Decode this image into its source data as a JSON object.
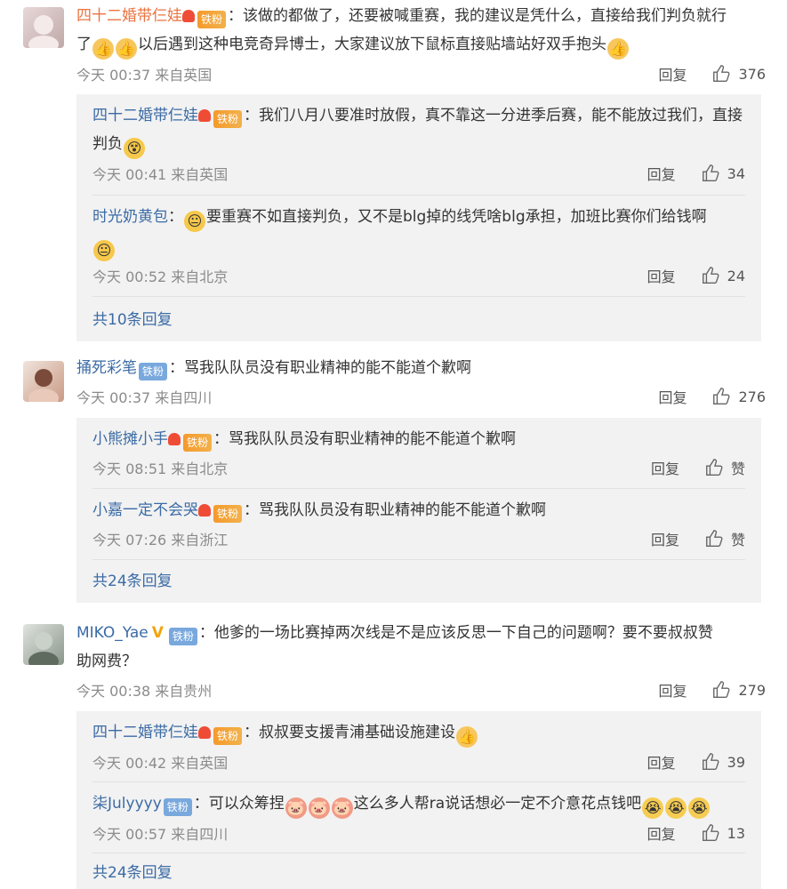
{
  "comments": [
    {
      "user": "四十二婚带仨娃",
      "badge": "铁粉",
      "text1": "：该做的都做了，还要被喊重赛，我的建议是凭什么，直接给我们判负就行",
      "text2a": "了",
      "text2b": "以后遇到这种电竞奇异博士，大家建议放下鼠标直接贴墙站好双手抱头",
      "meta": "今天 00:37 来自英国",
      "reply_label": "回复",
      "likes": "376",
      "replies": [
        {
          "user": "四十二婚带仨娃",
          "badge": "铁粉",
          "text": "：我们八月八要准时放假，真不靠这一分进季后赛，能不能放过我们，直接判负",
          "meta": "今天 00:41 来自英国",
          "reply_label": "回复",
          "likes": "34"
        },
        {
          "user": "时光奶黄包",
          "text": "：",
          "text_b": "要重赛不如直接判负，又不是blg掉的线凭啥blg承担，加班比赛你们给钱啊",
          "meta": "今天 00:52 来自北京",
          "reply_label": "回复",
          "likes": "24"
        }
      ],
      "more": "共10条回复"
    },
    {
      "user": "捅死彩笔",
      "badge": "铁粉",
      "text": "：骂我队队员没有职业精神的能不能道个歉啊",
      "meta": "今天 00:37 来自四川",
      "reply_label": "回复",
      "likes": "276",
      "replies": [
        {
          "user": "小熊摊小手",
          "badge": "铁粉",
          "text": "：骂我队队员没有职业精神的能不能道个歉啊",
          "meta": "今天 08:51 来自北京",
          "reply_label": "回复",
          "likes": "赞"
        },
        {
          "user": "小嘉一定不会哭",
          "badge": "铁粉",
          "text": "：骂我队队员没有职业精神的能不能道个歉啊",
          "meta": "今天 07:26 来自浙江",
          "reply_label": "回复",
          "likes": "赞"
        }
      ],
      "more": "共24条回复"
    },
    {
      "user": "MIKO_Yae",
      "vmark": "V",
      "badge": "铁粉",
      "text1": "：他爹的一场比赛掉两次线是不是应该反思一下自己的问题啊？要不要叔叔赞",
      "text2": "助网费？",
      "meta": "今天 00:38 来自贵州",
      "reply_label": "回复",
      "likes": "279",
      "replies": [
        {
          "user": "四十二婚带仨娃",
          "badge": "铁粉",
          "text": "：叔叔要支援青浦基础设施建设",
          "meta": "今天 00:42 来自英国",
          "reply_label": "回复",
          "likes": "39"
        },
        {
          "user": "柒Julyyyy",
          "badge": "铁粉",
          "text": "：可以众筹捏",
          "text_b": "这么多人帮ra说话想必一定不介意花点钱吧",
          "meta": "今天 00:57 来自四川",
          "reply_label": "回复",
          "likes": "13"
        }
      ],
      "more": "共24条回复"
    }
  ],
  "colors": {
    "name_orange": "#eb7340",
    "name_blue": "#3b6ba5",
    "reply_bg": "#f2f2f2",
    "meta": "#8b8b8b"
  }
}
